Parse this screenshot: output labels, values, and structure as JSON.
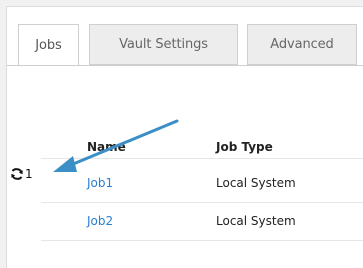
{
  "tabs": [
    {
      "label": "Jobs",
      "active": true
    },
    {
      "label": "Vault Settings",
      "active": false
    },
    {
      "label": "Advanced",
      "active": false
    }
  ],
  "table": {
    "columns": [
      "Name",
      "Job Type"
    ],
    "rows": [
      {
        "name": "Job1",
        "type": "Local System",
        "running_count": "1"
      },
      {
        "name": "Job2",
        "type": "Local System",
        "running_count": ""
      }
    ]
  },
  "icons": {
    "status": "sync-icon",
    "annotation": "callout-arrow"
  },
  "colors": {
    "link": "#2a7fd4",
    "arrow": "#3b8fc6",
    "tab_inactive": "#ededed"
  }
}
